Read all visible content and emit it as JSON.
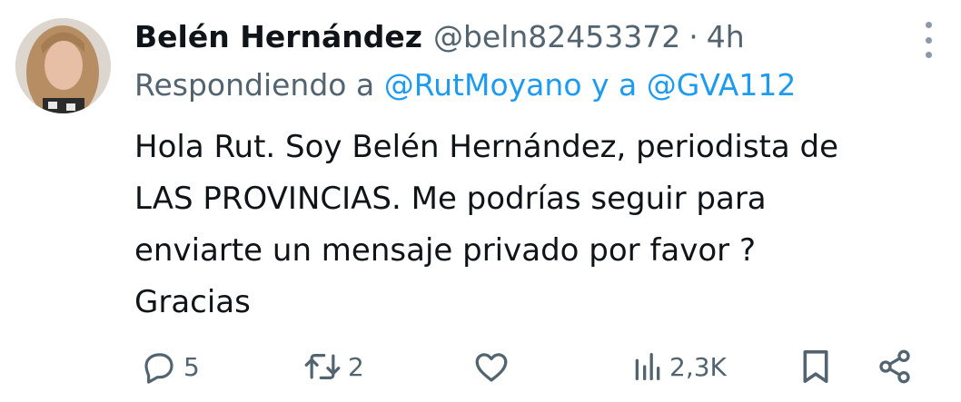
{
  "author": {
    "display_name": "Belén Hernández",
    "handle": "@beln82453372",
    "separator": "·",
    "time": "4h"
  },
  "replying_to": {
    "prefix": "Respondiendo a",
    "mention_1": "@RutMoyano",
    "conjunction": "y a",
    "mention_2": "@GVA112"
  },
  "body_lines": [
    "Hola Rut. Soy Belén Hernández, periodista de",
    "LAS PROVINCIAS. Me podrías seguir para",
    "enviarte un mensaje privado por favor ?",
    "Gracias"
  ],
  "actions": {
    "replies": "5",
    "reposts": "2",
    "likes": "",
    "views": "2,3K"
  },
  "colors": {
    "text": "#0f1419",
    "muted": "#536471",
    "link": "#1d9bf0"
  },
  "icons": [
    "more-options-icon",
    "reply-icon",
    "repost-icon",
    "like-icon",
    "views-icon",
    "bookmark-icon",
    "share-icon"
  ]
}
